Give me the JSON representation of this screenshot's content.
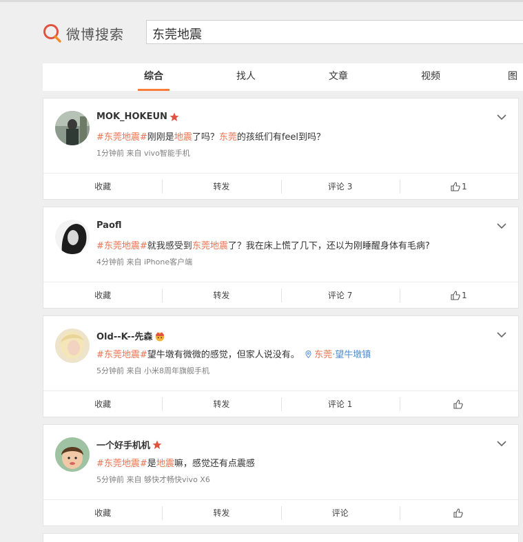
{
  "header": {
    "logo_text": "微博搜索",
    "search_value": "东莞地震"
  },
  "tabs": [
    {
      "label": "综合",
      "active": true
    },
    {
      "label": "找人",
      "active": false
    },
    {
      "label": "文章",
      "active": false
    },
    {
      "label": "视频",
      "active": false
    },
    {
      "label": "图",
      "active": false
    }
  ],
  "posts": [
    {
      "name": "MOK_HOKEUN",
      "badge": "star",
      "content_tag": "#东莞地震#",
      "content_a": "刚刚是",
      "content_hl": "地震",
      "content_b": "了吗？",
      "content_hl2": "东莞",
      "content_c": "的孩纸们有feel到吗？",
      "meta": "1分钟前 来自 vivo智能手机",
      "actions": {
        "collect": "收藏",
        "repost": "转发",
        "comment": "评论 3",
        "like": "1"
      }
    },
    {
      "name": "Paofl",
      "badge": "",
      "content_tag": "#东莞地震#",
      "content_a": "就我感受到",
      "content_hl": "东莞地震",
      "content_b": "了？我在床上慌了几下，还以为刚睡醒身体有毛病?",
      "meta": "4分钟前 来自 iPhone客户端",
      "actions": {
        "collect": "收藏",
        "repost": "转发",
        "comment": "评论 7",
        "like": "1"
      }
    },
    {
      "name": "Old--K--先森",
      "badge": "crown",
      "content_tag": "#东莞地震#",
      "content_a": "望牛墩有微微的感觉，但家人说没有。",
      "loc_icon": "location-pin-icon",
      "content_hl": "东莞",
      "loc_sep": "·",
      "loc_place": "望牛墩镇",
      "meta": "5分钟前 来自 小米8周年旗舰手机",
      "actions": {
        "collect": "收藏",
        "repost": "转发",
        "comment": "评论 1",
        "like": ""
      }
    },
    {
      "name": "一个好手机机",
      "badge": "star",
      "content_tag": "#东莞地震#",
      "content_a": "是",
      "content_hl": "地震",
      "content_b": "嘛，感觉还有点震感",
      "meta": "5分钟前 来自 够快才畅快vivo X6",
      "actions": {
        "collect": "收藏",
        "repost": "转发",
        "comment": "评论",
        "like": ""
      }
    }
  ]
}
